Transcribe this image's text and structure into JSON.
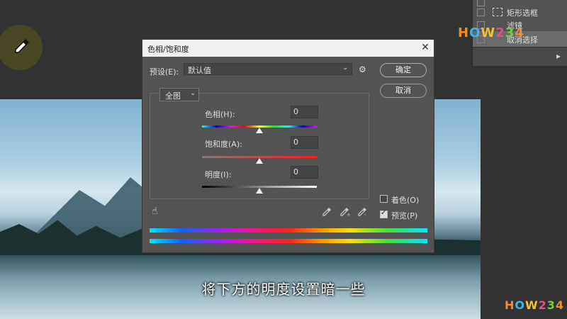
{
  "dialog": {
    "title": "色相/饱和度",
    "close_label": "✕",
    "preset_label": "预设(E):",
    "preset_value": "默认值",
    "ok_label": "确定",
    "cancel_label": "取消",
    "channel_value": "全图",
    "hue_label": "色相(H):",
    "hue_value": "0",
    "saturation_label": "饱和度(A):",
    "saturation_value": "0",
    "lightness_label": "明度(I):",
    "lightness_value": "0",
    "colorize_label": "着色(O)",
    "colorize_checked": false,
    "preview_label": "预览(P)",
    "preview_checked": true
  },
  "layers_panel": {
    "items": [
      {
        "label": "矩形选框"
      },
      {
        "label": "滤镜"
      },
      {
        "label": "取消选择"
      }
    ]
  },
  "watermark": {
    "brand": "HOW234"
  },
  "subtitle": "将下方的明度设置暗一些",
  "colors": {
    "dialog_bg": "#535353",
    "titlebar_bg": "#f0f0f0",
    "workspace_bg": "#323232"
  }
}
